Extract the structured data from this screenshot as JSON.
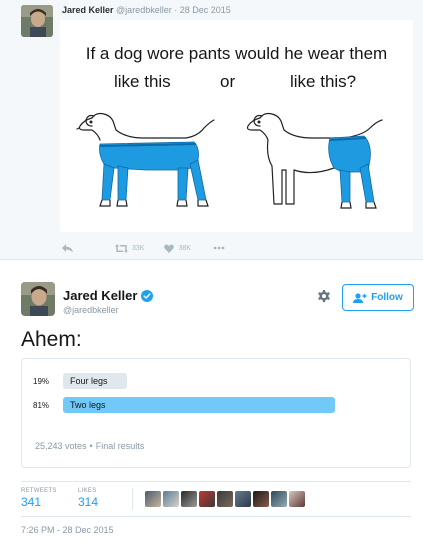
{
  "quoted_tweet": {
    "author_name": "Jared Keller",
    "author_handle": "@jaredbkeller",
    "separator": "·",
    "date": "28 Dec 2015",
    "media": {
      "question_line1": "If a dog wore pants would he wear them",
      "option_left": "like this",
      "option_or": "or",
      "option_right": "like this?"
    },
    "actions": {
      "retweets": "33K",
      "likes": "38K"
    }
  },
  "tweet": {
    "author_name": "Jared Keller",
    "author_handle": "@jaredbkeller",
    "follow_label": "Follow",
    "text": "Ahem:",
    "poll": {
      "options": [
        {
          "percent": "19%",
          "label": "Four legs",
          "fraction": 0.19
        },
        {
          "percent": "81%",
          "label": "Two legs",
          "fraction": 0.81
        }
      ],
      "votes": "25,243 votes",
      "dot": "•",
      "status": "Final results"
    },
    "stats": {
      "retweets_label": "RETWEETS",
      "retweets": "341",
      "likes_label": "LIKES",
      "likes": "314"
    },
    "timestamp": "7:26 PM - 28 Dec 2015"
  },
  "colors": {
    "accent": "#1da1f2",
    "poll_winner_bar": "#71c9f8",
    "poll_loser_bar": "#e1e8ed",
    "jeans": "#1e9be0",
    "muted": "#8899a6"
  },
  "icons": [
    "reply-icon",
    "retweet-icon",
    "heart-icon",
    "more-icon",
    "verified-badge-icon",
    "gear-icon",
    "follow-person-icon"
  ]
}
